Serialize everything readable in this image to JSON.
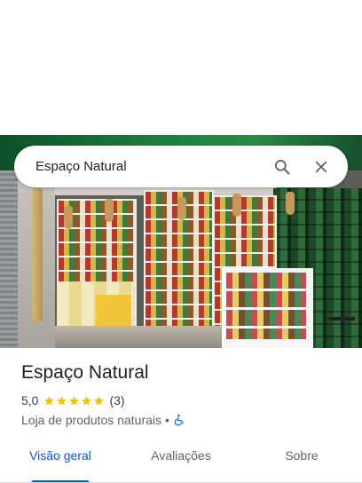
{
  "search": {
    "value": "Espaço Natural",
    "placeholder": ""
  },
  "place": {
    "name": "Espaço Natural",
    "rating": "5,0",
    "stars": 5,
    "review_count": "(3)",
    "category": "Loja de produtos naturais",
    "separator": "•"
  },
  "tabs": [
    {
      "label": "Visão geral",
      "active": true
    },
    {
      "label": "Avaliações",
      "active": false
    },
    {
      "label": "Sobre",
      "active": false
    }
  ],
  "colors": {
    "accent": "#0b57d0",
    "star": "#fbbc04",
    "text": "#202124",
    "muted": "#5f6368"
  },
  "icons": {
    "search": "search-icon",
    "close": "close-icon",
    "accessibility": "wheelchair-icon",
    "star": "star-icon"
  }
}
